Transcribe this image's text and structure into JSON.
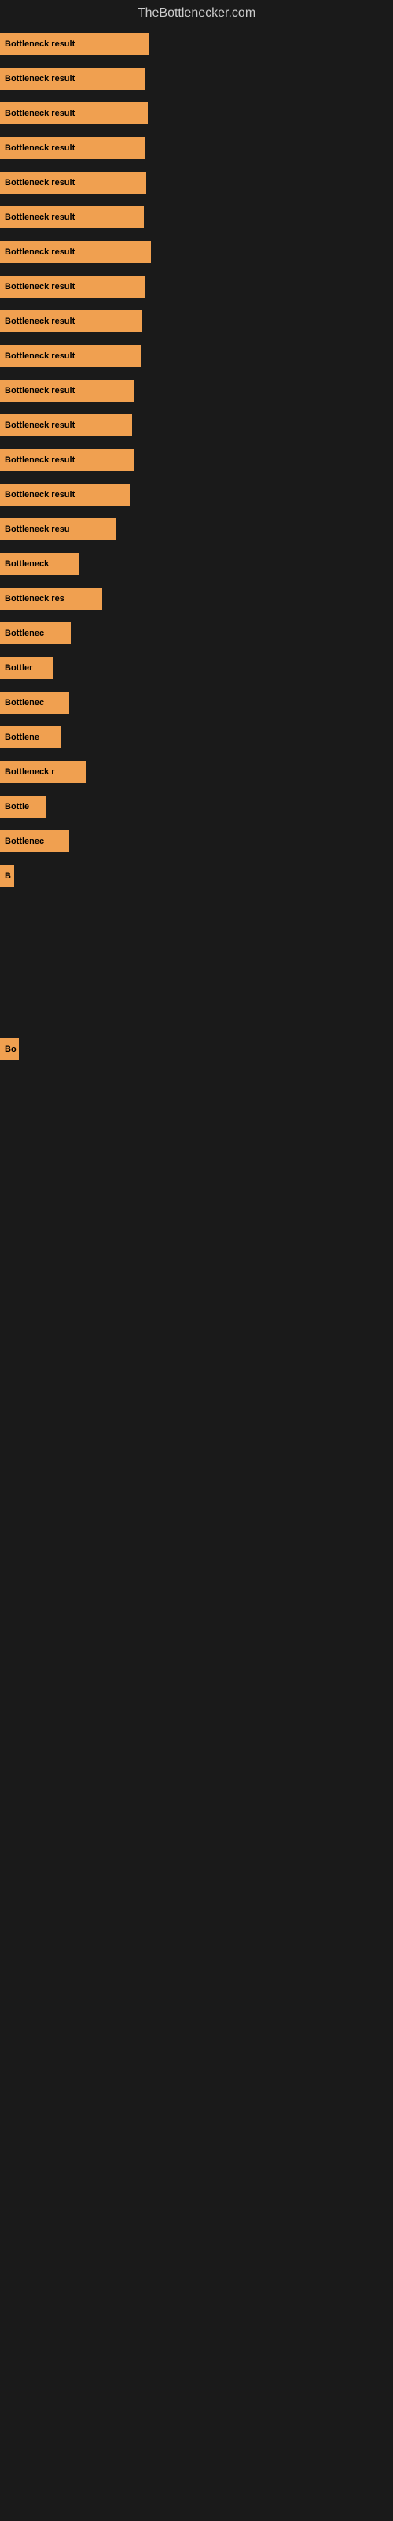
{
  "site": {
    "title": "TheBottlenecker.com"
  },
  "bars": [
    {
      "label": "Bottleneck result",
      "width": 190
    },
    {
      "label": "Bottleneck result",
      "width": 185
    },
    {
      "label": "Bottleneck result",
      "width": 188
    },
    {
      "label": "Bottleneck result",
      "width": 184
    },
    {
      "label": "Bottleneck result",
      "width": 186
    },
    {
      "label": "Bottleneck result",
      "width": 183
    },
    {
      "label": "Bottleneck result",
      "width": 192
    },
    {
      "label": "Bottleneck result",
      "width": 184
    },
    {
      "label": "Bottleneck result",
      "width": 181
    },
    {
      "label": "Bottleneck result",
      "width": 179
    },
    {
      "label": "Bottleneck result",
      "width": 171
    },
    {
      "label": "Bottleneck result",
      "width": 168
    },
    {
      "label": "Bottleneck result",
      "width": 170
    },
    {
      "label": "Bottleneck result",
      "width": 165
    },
    {
      "label": "Bottleneck resu",
      "width": 148
    },
    {
      "label": "Bottleneck",
      "width": 100
    },
    {
      "label": "Bottleneck res",
      "width": 130
    },
    {
      "label": "Bottlenec",
      "width": 90
    },
    {
      "label": "Bottler",
      "width": 68
    },
    {
      "label": "Bottlenec",
      "width": 88
    },
    {
      "label": "Bottlene",
      "width": 78
    },
    {
      "label": "Bottleneck r",
      "width": 110
    },
    {
      "label": "Bottle",
      "width": 58
    },
    {
      "label": "Bottlenec",
      "width": 88
    },
    {
      "label": "B",
      "width": 18
    },
    {
      "label": "",
      "width": 0
    },
    {
      "label": "",
      "width": 0
    },
    {
      "label": "",
      "width": 0
    },
    {
      "label": "",
      "width": 0
    },
    {
      "label": "Bo",
      "width": 24
    },
    {
      "label": "",
      "width": 0
    },
    {
      "label": "",
      "width": 0
    },
    {
      "label": "",
      "width": 0
    },
    {
      "label": "",
      "width": 0
    },
    {
      "label": "",
      "width": 0
    }
  ]
}
